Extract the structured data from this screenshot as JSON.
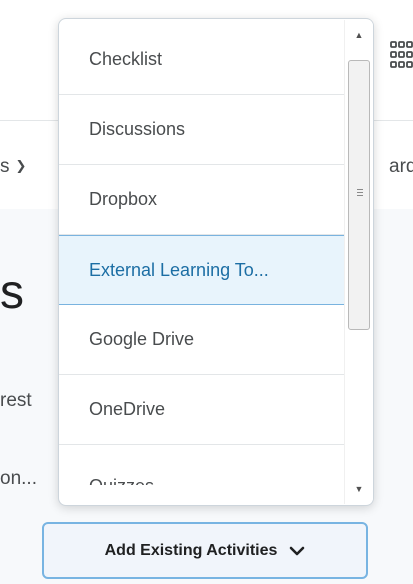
{
  "background": {
    "nav_left_text": "s",
    "nav_right_text": "ard",
    "heading_fragment": "s",
    "row1_fragment": "rest",
    "row2_fragment": "on..."
  },
  "menu": {
    "items": [
      {
        "label": "Checklist"
      },
      {
        "label": "Discussions"
      },
      {
        "label": "Dropbox"
      },
      {
        "label": "External Learning To...",
        "selected": true
      },
      {
        "label": "Google Drive"
      },
      {
        "label": "OneDrive"
      },
      {
        "label": "Quizzes"
      }
    ]
  },
  "add_button": {
    "label": "Add Existing Activities"
  },
  "colors": {
    "selected_bg": "#e8f4fc",
    "selected_border": "#79b3df",
    "selected_text": "#1c6ea4",
    "button_border": "#78b4e2"
  }
}
